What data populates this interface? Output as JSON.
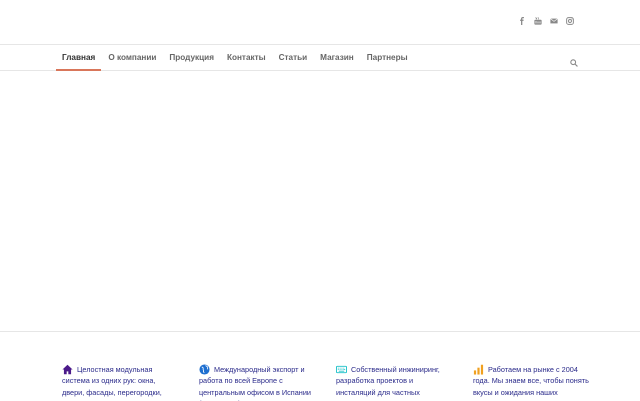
{
  "header": {
    "social": [
      {
        "icon": "facebook-icon"
      },
      {
        "icon": "youtube-icon"
      },
      {
        "icon": "mail-icon"
      },
      {
        "icon": "instagram-icon"
      }
    ]
  },
  "nav": {
    "items": [
      {
        "label": "Главная",
        "active": true
      },
      {
        "label": "О компании"
      },
      {
        "label": "Продукция"
      },
      {
        "label": "Контакты"
      },
      {
        "label": "Статьи"
      },
      {
        "label": "Магазин"
      },
      {
        "label": "Партнеры"
      }
    ],
    "search_icon": "search-icon",
    "active_color": "#d9765a"
  },
  "features": [
    {
      "icon": "home-icon",
      "color": "#4b1a8a",
      "text": "Целостная модульная система из одних рук: окна, двери, фасады, перегородки, лестницы и"
    },
    {
      "icon": "globe-icon",
      "color": "#1e6fd0",
      "text": "Международный экспорт и работа по всей Европе с центральным офисом в Испании (Барселона)"
    },
    {
      "icon": "keyboard-icon",
      "color": "#19c0c8",
      "text": "Собственный инжиниринг, разработка проектов и инсталяций для частных клиентов"
    },
    {
      "icon": "chart-icon",
      "color": "#f0a020",
      "text": "Работаем на рынке с 2004 года. Мы знаем все, чтобы понять вкусы и ожидания наших клиентов"
    }
  ]
}
